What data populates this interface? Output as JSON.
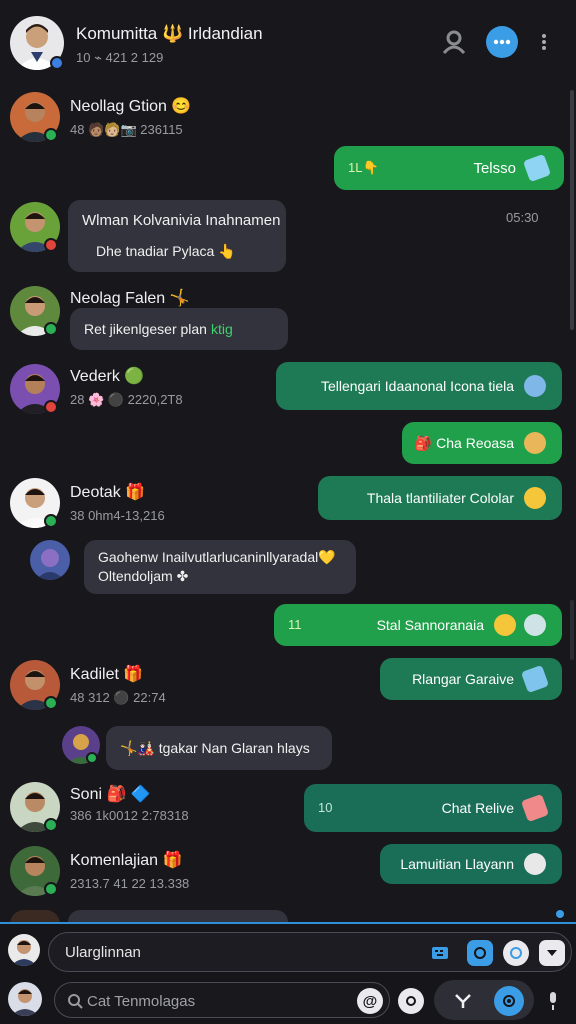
{
  "header": {
    "title": "Komumitta 🔱 Irldandian",
    "meta": "10 ⌁ 421 2 129"
  },
  "messages": [
    {
      "name": "Neollag Gtion 😊",
      "meta": "48 🧑🏽🧑🏼📷 236115"
    },
    {
      "out_text": "Telsso",
      "out_lead": "1L👇"
    },
    {
      "name": "Wlman Kolvanivia Inahnamen",
      "in_text": "Dhe tnadiar Pylaca 👆",
      "time": "05:30"
    },
    {
      "name": "Neolag Falen 🤸",
      "in_text": "Ret jikenlgeser plan",
      "in_accent": "ktig"
    },
    {
      "name": "Vederk 🟢",
      "meta": "28 🌸 ⚫ 2220,2T8",
      "out_text": "Tellengari Idaanonal Icona tiela"
    },
    {
      "out_text": "🎒 Cha Reoasa"
    },
    {
      "name": "Deotak 🎁",
      "meta": "38 0hm4-13,216",
      "out_text": "Thala tlantiliater Cololar"
    },
    {
      "in_text": "Gaohenw Inailvutlarlucaninllyaradal💛",
      "in_text2": "Oltendoljam ✤"
    },
    {
      "out_text": "Stal Sannoranaia",
      "out_lead": "11"
    },
    {
      "name": "Kadilet 🎁",
      "meta": "48 312 ⚫ 22:74",
      "out_text": "Rlangar Garaive"
    },
    {
      "in_text": "🤸🎎 tgakar Nan Glaran hlays"
    },
    {
      "name": "Soni 🎒 🔷",
      "meta": "386 1k0012 2:78318",
      "out_text": "Chat Relive",
      "out_lead": "10"
    },
    {
      "name": "Komenlajian 🎁",
      "meta": "2313.7 41 22 13.338",
      "out_text": "Lamuitian Llayann"
    }
  ],
  "composer": {
    "message_value": "Ularglinnan",
    "search_placeholder": "Cat Tenmolagas"
  },
  "colors": {
    "background": "#17171c",
    "incoming_bubble": "#33333d",
    "outgoing_bubble": "#21a04b",
    "outgoing_bubble_alt": "#1e7a55",
    "accent_blue": "#2f8fd8"
  }
}
